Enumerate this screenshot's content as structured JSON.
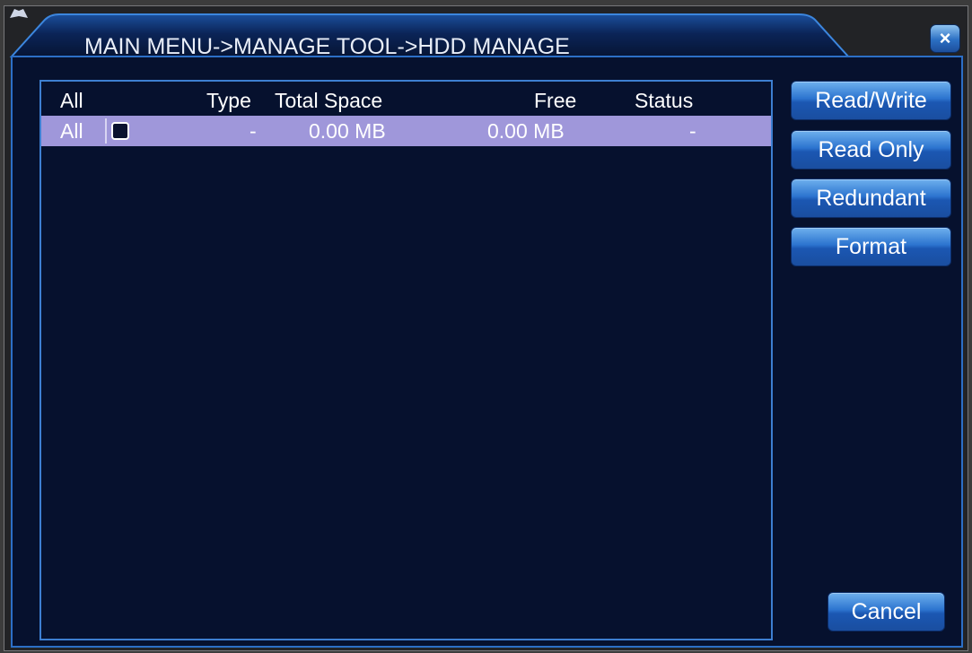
{
  "window": {
    "title": "MAIN MENU->MANAGE TOOL->HDD MANAGE",
    "close_label": "×"
  },
  "table": {
    "headers": [
      "All",
      "Type",
      "Total Space",
      "Free",
      "Status"
    ],
    "rows": [
      {
        "all": "All",
        "selected": false,
        "type": "-",
        "total_space": "0.00 MB",
        "free": "0.00 MB",
        "status": "-"
      }
    ],
    "row_highlight_color": "#9f97da"
  },
  "actions": {
    "read_write": "Read/Write",
    "read_only": "Read Only",
    "redundant": "Redundant",
    "format": "Format",
    "cancel": "Cancel"
  },
  "colors": {
    "panel_background": "#06112e",
    "accent_blue": "#2c6fc6",
    "button_blue": "#2c74cf"
  },
  "icons": {
    "title": "menu-book-icon",
    "close": "close-icon"
  }
}
